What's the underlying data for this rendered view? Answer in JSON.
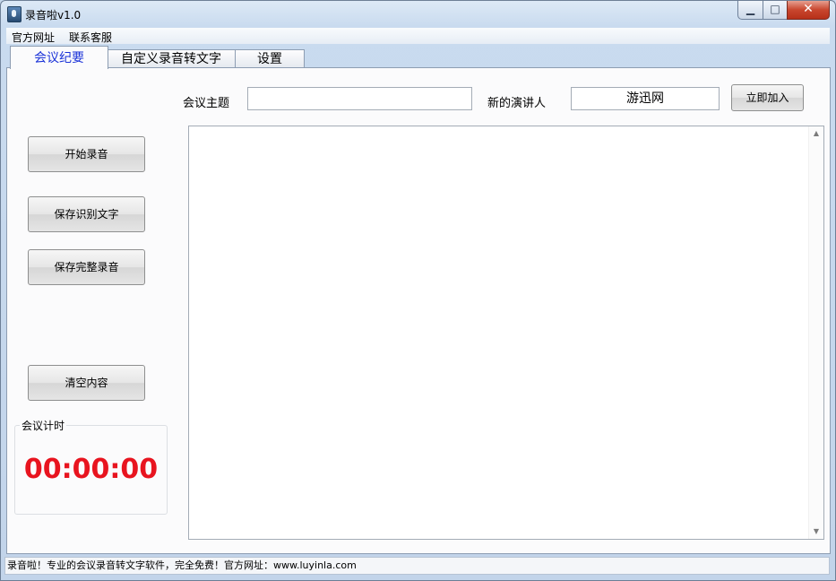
{
  "window": {
    "title": "录音啦v1.0",
    "minimize_glyph": "▁",
    "maximize_glyph": "□",
    "close_glyph": "✕"
  },
  "menu": [
    {
      "label": "官方网址"
    },
    {
      "label": "联系客服"
    }
  ],
  "tabs": [
    {
      "label": "会议纪要"
    },
    {
      "label": "自定义录音转文字"
    },
    {
      "label": "设置"
    }
  ],
  "meeting": {
    "topic_label": "会议主题",
    "topic_value": "",
    "speaker_label": "新的演讲人",
    "speaker_value": "游迅网",
    "add_button": "立即加入"
  },
  "buttons": {
    "start": "开始录音",
    "save_text": "保存识别文字",
    "save_audio": "保存完整录音",
    "clear": "清空内容"
  },
  "timer": {
    "label": "会议计时",
    "value": "00:00:00",
    "color": "#e8141f"
  },
  "scroll": {
    "up_glyph": "▲",
    "down_glyph": "▼"
  },
  "status": {
    "text": "录音啦！专业的会议录音转文字软件，完全免费！官方网址：www.luyinla.com"
  },
  "colors": {
    "active_tab": "#1a32d8"
  }
}
